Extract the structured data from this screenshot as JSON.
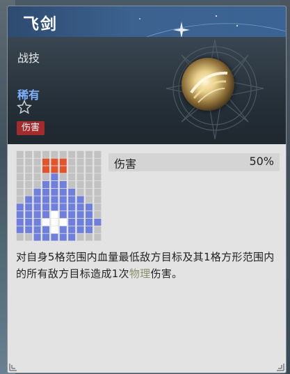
{
  "skill": {
    "name": "飞剑",
    "category": "战技",
    "rarity": "稀有",
    "tag": "伤害",
    "stat": {
      "label": "伤害",
      "value": "50%"
    },
    "description_before": "对自身5格范围内血量最低敌方目标及其1格方形范围内的所有敌方目标造成1次",
    "keyword": "物理",
    "description_after": "伤害。"
  },
  "colors": {
    "range_cell": "#6f7fdc",
    "target_cell": "#ffffff",
    "aoe_cell": "#e2542b",
    "empty_cell": "#c2c2c2",
    "rarity": "#7fb2ff",
    "tag_bg": "#a32b2b"
  },
  "range_grid": [
    "..........",
    "...AAA....",
    "...AAA....",
    "....B.....",
    "...BBB....",
    "..BBBBB...",
    ".BBBBBBB..",
    "BBBBBBBBB.",
    "BBBBCBBBB.",
    "BBBCCCBBBB",
    "BBBBCBBBB.",
    "..BBBBB..."
  ],
  "icons": [
    "star-outline-icon",
    "skill-orb-icon",
    "compass-emblem-icon",
    "corner-ornament-icon"
  ]
}
